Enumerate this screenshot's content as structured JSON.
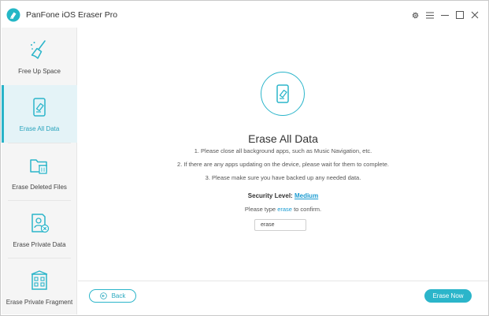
{
  "window": {
    "title": "PanFone iOS Eraser Pro"
  },
  "sidebar": {
    "items": [
      {
        "label": "Free Up Space",
        "icon": "broom-icon"
      },
      {
        "label": "Erase All Data",
        "icon": "phone-eraser-icon",
        "active": true
      },
      {
        "label": "Erase Deleted Files",
        "icon": "folder-trash-icon"
      },
      {
        "label": "Erase Private Data",
        "icon": "private-data-icon"
      },
      {
        "label": "Erase Private Fragment",
        "icon": "fragment-icon"
      }
    ]
  },
  "main": {
    "heading": "Erase All Data",
    "steps": [
      "1. Please close all background apps, such as Music Navigation, etc.",
      "2. If there are any apps updating on the device, please wait for them to complete.",
      "3. Please make sure you have backed up any needed data."
    ],
    "security_label": "Security Level:",
    "security_level": "Medium",
    "confirm_prefix": "Please type",
    "confirm_word": "erase",
    "confirm_suffix": "to confirm.",
    "input_value": "erase"
  },
  "footer": {
    "back_label": "Back",
    "erase_label": "Erase Now"
  },
  "colors": {
    "accent": "#2bb5ca",
    "link": "#1a9bd1"
  }
}
